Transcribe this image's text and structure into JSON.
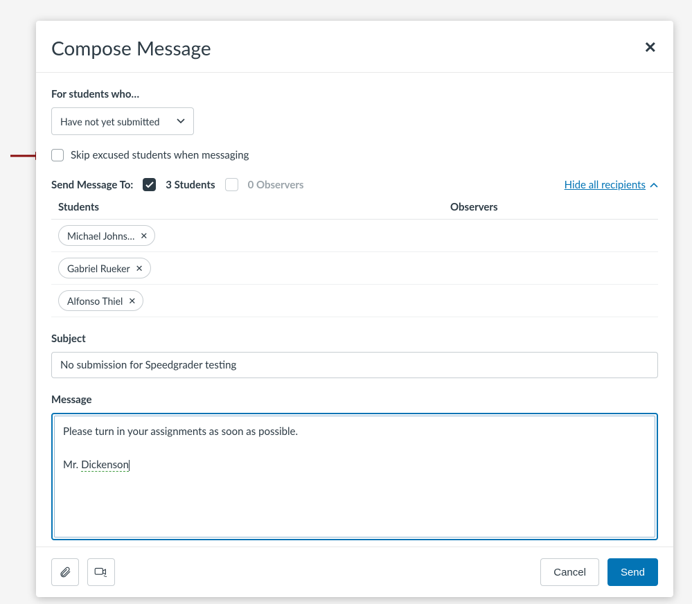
{
  "modal": {
    "title": "Compose Message",
    "criteria_label": "For students who…",
    "criteria_selected": "Have not yet submitted",
    "skip_excused_label": "Skip excused students when messaging",
    "send_to_label": "Send Message To:",
    "students_count": "3 Students",
    "observers_count": "0 Observers",
    "hide_recipients": "Hide all recipients",
    "col_students": "Students",
    "col_observers": "Observers",
    "students": [
      "Michael Johns…",
      "Gabriel Rueker",
      "Alfonso Thiel"
    ],
    "subject_label": "Subject",
    "subject_value": "No submission for Speedgrader testing",
    "message_label": "Message",
    "message_line1": "Please turn in your assignments as soon as possible.",
    "message_line2_prefix": "Mr. ",
    "message_line2_name": "Dickenson"
  },
  "footer": {
    "cancel": "Cancel",
    "send": "Send"
  }
}
